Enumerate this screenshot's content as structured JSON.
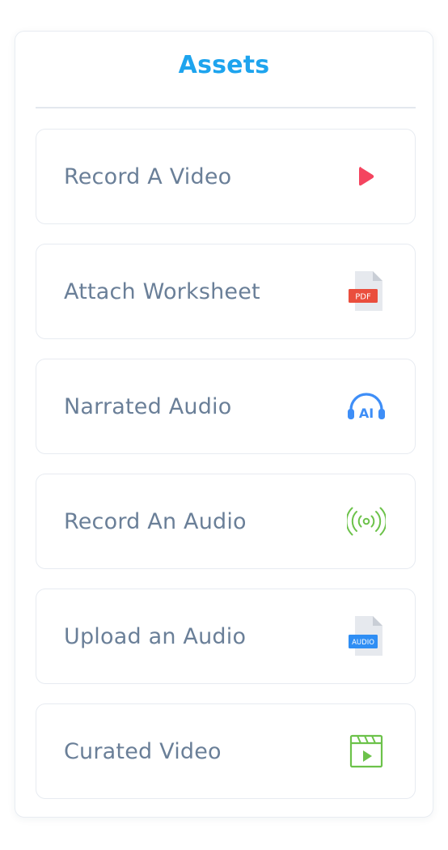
{
  "panel": {
    "title": "Assets"
  },
  "items": [
    {
      "label": "Record A Video",
      "icon": "play-icon",
      "color": "#f4445f"
    },
    {
      "label": "Attach Worksheet",
      "icon": "pdf-file-icon",
      "color": "#ea4e3d",
      "badge": "PDF"
    },
    {
      "label": "Narrated Audio",
      "icon": "ai-headphones-icon",
      "color": "#3e8ef7",
      "badge": "AI"
    },
    {
      "label": "Record An Audio",
      "icon": "broadcast-icon",
      "color": "#6cc24a"
    },
    {
      "label": "Upload an Audio",
      "icon": "audio-file-icon",
      "color": "#2f8ef4",
      "badge": "AUDIO"
    },
    {
      "label": "Curated Video",
      "icon": "video-clapper-icon",
      "color": "#6cc24a"
    }
  ]
}
